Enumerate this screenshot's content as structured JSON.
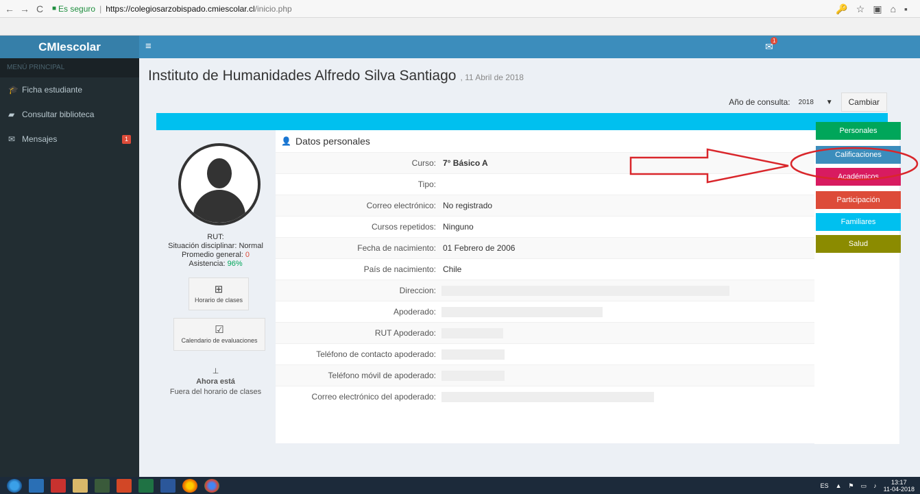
{
  "browser": {
    "secure_label": "Es seguro",
    "host": "https://colegiosarzobispado.cmiescolar.cl",
    "path": "/inicio.php",
    "back_icon": "←",
    "forward_icon": "→",
    "reload_icon": "C",
    "key_icon": "🔑",
    "star_icon": "☆",
    "home_icon": "⌂"
  },
  "app": {
    "brand": "CMIescolar",
    "menu_icon": "≡",
    "mail_badge": "1"
  },
  "sidebar": {
    "header": "MENÚ PRINCIPAL",
    "items": [
      {
        "label": "Ficha estudiante",
        "icon": "graduation-cap-icon",
        "glyph": "🎓"
      },
      {
        "label": "Consultar biblioteca",
        "icon": "book-icon",
        "glyph": "▰"
      },
      {
        "label": "Mensajes",
        "icon": "envelope-icon",
        "glyph": "✉",
        "badge": "1"
      }
    ]
  },
  "header": {
    "title": "Instituto de Humanidades Alfredo Silva Santiago",
    "date": ", 11 Abril de 2018"
  },
  "year": {
    "label": "Año de consulta:",
    "value": "2018",
    "arrow": "▼",
    "button": "Cambiar"
  },
  "profile": {
    "rut_label": "RUT:",
    "situacion": "Situación disciplinar: Normal",
    "promedio_label": "Promedio general: ",
    "promedio_value": "0",
    "asistencia_label": "Asistencia: ",
    "asistencia_value": "96%",
    "horario_btn": "Horario de clases",
    "calendario_btn": "Calendario de evaluaciones",
    "ahora_label": "Ahora está",
    "ahora_value": "Fuera del horario de clases"
  },
  "details": {
    "title": "Datos personales",
    "rows": [
      {
        "label": "Curso:",
        "value": "7° Básico A",
        "bold": true
      },
      {
        "label": "Tipo:",
        "value": ""
      },
      {
        "label": "Correo electrónico:",
        "value": "No registrado"
      },
      {
        "label": "Cursos repetidos:",
        "value": "Ninguno"
      },
      {
        "label": "Fecha de nacimiento:",
        "value": "01 Febrero de 2006"
      },
      {
        "label": "País de nacimiento:",
        "value": "Chile"
      },
      {
        "label": "Direccion:",
        "value": ""
      },
      {
        "label": "Apoderado:",
        "value": ""
      },
      {
        "label": "RUT Apoderado:",
        "value": ""
      },
      {
        "label": "Teléfono de contacto apoderado:",
        "value": ""
      },
      {
        "label": "Teléfono móvil de apoderado:",
        "value": ""
      },
      {
        "label": "Correo electrónico del apoderado:",
        "value": ""
      }
    ]
  },
  "side_buttons": [
    {
      "label": "Personales",
      "color": "#00a65a"
    },
    {
      "label": "Calificaciones",
      "color": "#3c8dbc"
    },
    {
      "label": "Académicos",
      "color": "#d81b60"
    },
    {
      "label": "Participación",
      "color": "#dd4b39"
    },
    {
      "label": "Familiares",
      "color": "#00c0ef"
    },
    {
      "label": "Salud",
      "color": "#8b8b00"
    }
  ],
  "taskbar": {
    "lang": "ES",
    "time": "13:17",
    "date": "11-04-2018"
  }
}
